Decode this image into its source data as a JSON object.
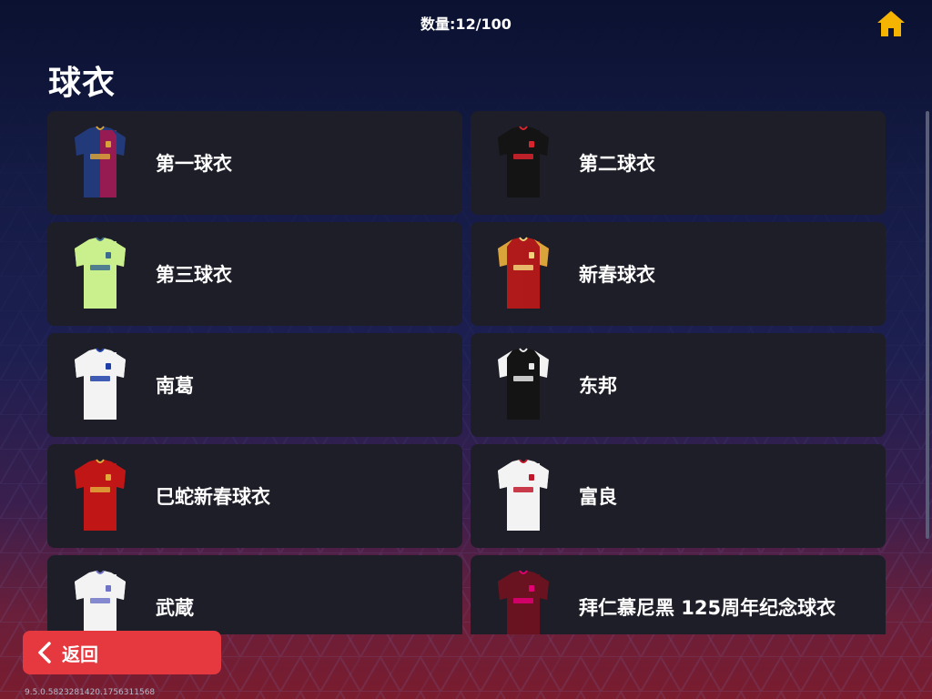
{
  "header": {
    "count_text": "数量:12/100",
    "home_icon": "home-icon",
    "home_color": "#f4b400"
  },
  "page": {
    "title": "球衣"
  },
  "jerseys": [
    {
      "label": "第一球衣",
      "icon": "jersey-icon",
      "body": "#22397a",
      "stripe": "#a3184f",
      "sleeve": "#22397a",
      "accent": "#d8a23a"
    },
    {
      "label": "第二球衣",
      "icon": "jersey-icon",
      "body": "#141414",
      "stripe": "#141414",
      "sleeve": "#141414",
      "accent": "#d9232d"
    },
    {
      "label": "第三球衣",
      "icon": "jersey-icon",
      "body": "#c9f08c",
      "stripe": "#c9f08c",
      "sleeve": "#c9f08c",
      "accent": "#3c6a8e"
    },
    {
      "label": "新春球衣",
      "icon": "jersey-icon",
      "body": "#b01a1a",
      "stripe": "#b01a1a",
      "sleeve": "#d9a43a",
      "accent": "#f2d27a"
    },
    {
      "label": "南葛",
      "icon": "jersey-icon",
      "body": "#f3f3f3",
      "stripe": "#f3f3f3",
      "sleeve": "#f3f3f3",
      "accent": "#1f3fa8"
    },
    {
      "label": "东邦",
      "icon": "jersey-icon",
      "body": "#141414",
      "stripe": "#141414",
      "sleeve": "#f3f3f3",
      "accent": "#e8e8e8"
    },
    {
      "label": "巳蛇新春球衣",
      "icon": "jersey-icon",
      "body": "#c01616",
      "stripe": "#c01616",
      "sleeve": "#c01616",
      "accent": "#e0a93a"
    },
    {
      "label": "富良",
      "icon": "jersey-icon",
      "body": "#f3f3f3",
      "stripe": "#f3f3f3",
      "sleeve": "#f3f3f3",
      "accent": "#c0182a"
    },
    {
      "label": "武蔵",
      "icon": "jersey-icon",
      "body": "#f3f3f3",
      "stripe": "#f3f3f3",
      "sleeve": "#f3f3f3",
      "accent": "#6f74c8"
    },
    {
      "label": "拜仁慕尼黑 125周年纪念球衣",
      "icon": "jersey-icon",
      "body": "#6a1320",
      "stripe": "#6a1320",
      "sleeve": "#6a1320",
      "accent": "#e20074"
    }
  ],
  "footer": {
    "back_label": "返回",
    "back_icon": "chevron-left-icon",
    "back_color": "#e5393f",
    "version": "9.5.0.5823281420.1756311568"
  }
}
